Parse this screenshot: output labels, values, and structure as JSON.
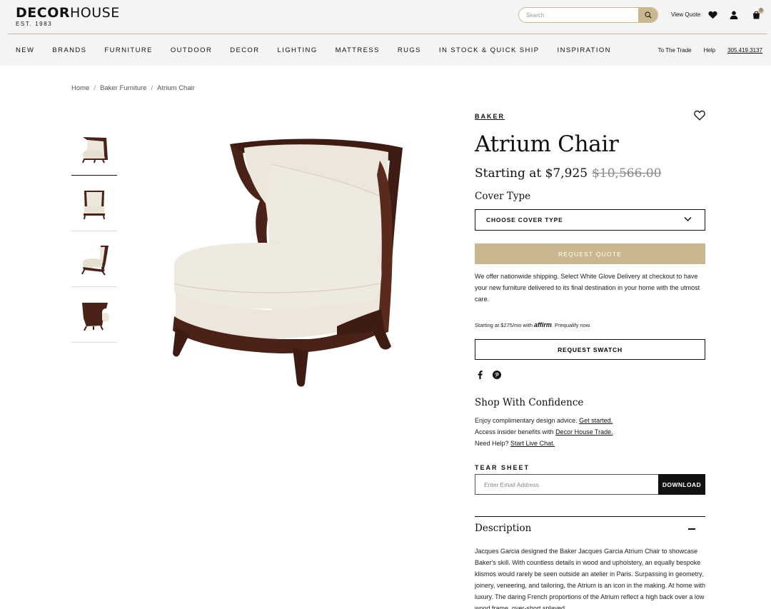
{
  "brand": {
    "logo_bold": "DECOR",
    "logo_light": "HOUSE",
    "est": "EST. 1983"
  },
  "search": {
    "placeholder": "Search"
  },
  "header": {
    "view_quote": "View Quote",
    "cart_count": "0",
    "icons": [
      "search-icon",
      "heart-icon",
      "user-icon",
      "cart-icon"
    ]
  },
  "nav": {
    "items": [
      "NEW",
      "BRANDS",
      "FURNITURE",
      "OUTDOOR",
      "DECOR",
      "LIGHTING",
      "MATTRESS",
      "RUGS",
      "IN STOCK & QUICK SHIP",
      "INSPIRATION"
    ],
    "util": [
      "To The Trade",
      "Help"
    ],
    "phone": "305.419.3137"
  },
  "breadcrumb": [
    "Home",
    "Baker Furniture",
    "Atrium Chair"
  ],
  "product": {
    "brand": "BAKER",
    "title": "Atrium Chair",
    "price_prefix": "Starting at $7,925",
    "price_original": "$10,566.00",
    "cover_label": "Cover Type",
    "cover_select": "CHOOSE COVER TYPE",
    "request_quote": "REQUEST QUOTE",
    "shipping_text": "We offer nationwide shipping. Select White Glove Delivery at checkout to have your new furniture delivered to its final destination in your home with the utmost care.",
    "affirm_prefix": "Starting at $275/mo with",
    "affirm_logo": "affirm",
    "affirm_suffix": ". Prequalify now.",
    "request_swatch": "REQUEST SWATCH",
    "confidence_title": "Shop With Confidence",
    "confidence": [
      {
        "text": "Enjoy complimentary design advice. ",
        "link": "Get started."
      },
      {
        "text": "Access insider benefits with ",
        "link": "Decor House Trade."
      },
      {
        "text": "Need Help? ",
        "link": "Start Live Chat."
      }
    ],
    "tear_sheet_title": "TEAR SHEET",
    "email_placeholder": "Enter Email Address",
    "download": "DOWNLOAD",
    "description_title": "Description",
    "description": "Jacques Garcia designed the Baker Jacques Garcia Atrium Chair to showcase Baker's skill. With countless details in wood and upholstery, an equally bespoke klismos would rarely be seen outside an atelier in Paris. Surpassing in geometry, joinery, veneering, and tailoring, the Atrium is an icon in the making. At home with luxury. The daring French proportions of the Atrium reflect a high back over a low wood frame, over-short splayed"
  },
  "colors": {
    "accent": "#c9b88f",
    "wood": "#4a2218",
    "fabric": "#ede8dc",
    "header_bg": "#f4f4f4"
  }
}
